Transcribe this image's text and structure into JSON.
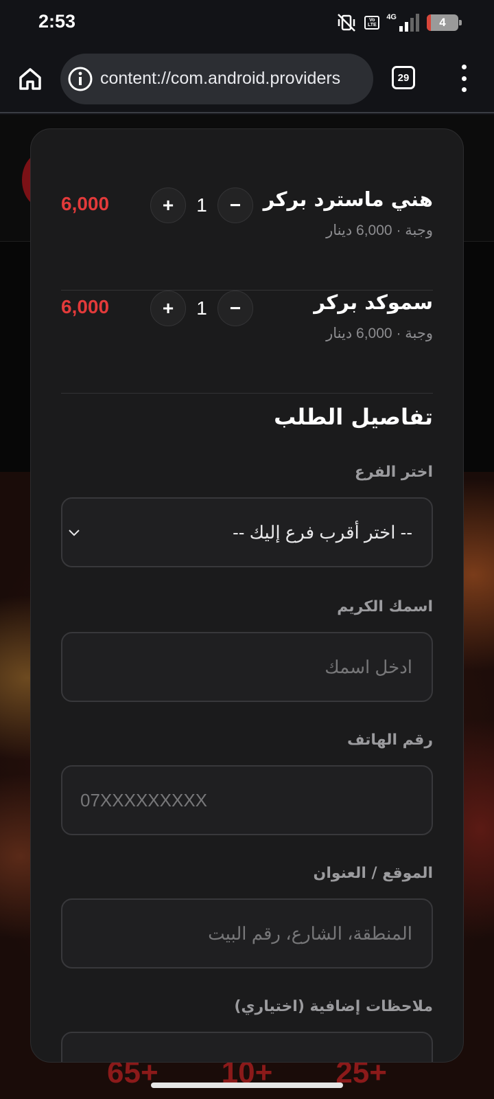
{
  "status_bar": {
    "time": "2:53",
    "network": "4G",
    "volte": "Vo LTE",
    "battery_level": "4"
  },
  "browser": {
    "url": "content://com.android.providers",
    "tab_count": "29",
    "icons": [
      "home-icon",
      "info-icon",
      "tab-switcher",
      "more-vert-icon"
    ]
  },
  "background_page": {
    "stats": [
      "65+",
      "10+",
      "25+"
    ]
  },
  "cart": {
    "items": [
      {
        "name": "هني ماسترد بركر",
        "subtitle": "وجبة · 6,000 دينار",
        "quantity": "1",
        "price": "6,000",
        "plus": "+",
        "minus": "−"
      },
      {
        "name": "سموكد بركر",
        "subtitle": "وجبة · 6,000 دينار",
        "quantity": "1",
        "price": "6,000",
        "plus": "+",
        "minus": "−"
      }
    ]
  },
  "order_details": {
    "title": "تفاصيل الطلب",
    "branch": {
      "label": "اختر الفرع",
      "selected": "-- اختر أقرب فرع إليك --"
    },
    "name": {
      "label": "اسمك الكريم",
      "placeholder": "ادخل اسمك"
    },
    "phone": {
      "label": "رقم الهاتف",
      "placeholder": "07XXXXXXXXX"
    },
    "address": {
      "label": "الموقع / العنوان",
      "placeholder": "المنطقة، الشارع، رقم البيت"
    },
    "notes": {
      "label": "ملاحظات إضافية (اختياري)"
    }
  },
  "colors": {
    "accent": "#e23a3a",
    "modal_bg": "#1b1b1c",
    "field_border": "#38383b"
  }
}
